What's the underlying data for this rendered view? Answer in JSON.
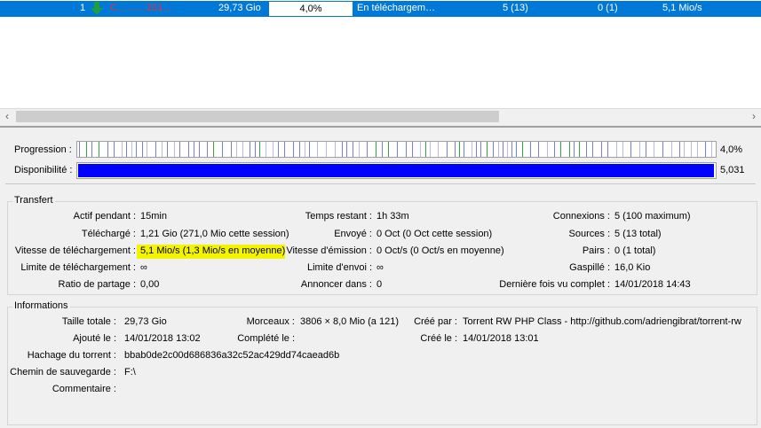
{
  "torrent_row": {
    "index": "1",
    "name": "C………201…",
    "size": "29,73 Gio",
    "progress": "4,0%",
    "status": "En téléchargem…",
    "seeds": "5 (13)",
    "peers": "0 (1)",
    "speed": "5,1 Mio/s",
    "status_icon": "download-arrow-icon"
  },
  "bars": {
    "progress_label": "Progression :",
    "progress_value": "4,0%",
    "progress_fraction": 0.04,
    "availability_label": "Disponibilité :",
    "availability_value": "5,031"
  },
  "transfer": {
    "title": "Transfert",
    "active_label": "Actif pendant :",
    "active_value": "15min",
    "downloaded_label": "Téléchargé :",
    "downloaded_value": "1,21 Gio (271,0 Mio cette session)",
    "dl_speed_label": "Vitesse de téléchargement :",
    "dl_speed_value": "5,1 Mio/s (1,3 Mio/s en moyenne)",
    "dl_limit_label": "Limite de téléchargement :",
    "dl_limit_value": "∞",
    "ratio_label": "Ratio de partage :",
    "ratio_value": "0,00",
    "eta_label": "Temps restant :",
    "eta_value": "1h 33m",
    "uploaded_label": "Envoyé :",
    "uploaded_value": "0 Oct (0 Oct cette session)",
    "ul_speed_label": "Vitesse d'émission :",
    "ul_speed_value": "0 Oct/s (0 Oct/s en moyenne)",
    "ul_limit_label": "Limite d'envoi :",
    "ul_limit_value": "∞",
    "announce_label": "Annoncer dans :",
    "announce_value": "0",
    "connections_label": "Connexions :",
    "connections_value": "5 (100 maximum)",
    "sources_label": "Sources :",
    "sources_value": "5 (13 total)",
    "peers_label": "Pairs :",
    "peers_value": "0 (1 total)",
    "wasted_label": "Gaspillé :",
    "wasted_value": "16,0 Kio",
    "last_complete_label": "Dernière fois vu complet :",
    "last_complete_value": "14/01/2018 14:43"
  },
  "info": {
    "title": "Informations",
    "total_size_label": "Taille totale :",
    "total_size_value": "29,73 Gio",
    "added_label": "Ajouté le :",
    "added_value": "14/01/2018 13:02",
    "hash_label": "Hachage du torrent :",
    "hash_value": "bbab0de2c00d686836a32c52ac429dd74caead6b",
    "save_path_label": "Chemin de sauvegarde :",
    "save_path_value": "F:\\",
    "comment_label": "Commentaire :",
    "comment_value": "",
    "pieces_label": "Morceaux :",
    "pieces_value": "3806 × 8,0 Mio (a 121)",
    "completed_label": "Complété le :",
    "completed_value": "",
    "created_by_label": "Créé par :",
    "created_by_value": "Torrent RW PHP Class - http://github.com/adriengibrat/torrent-rw",
    "created_on_label": "Créé le :",
    "created_on_value": "14/01/2018 13:01"
  },
  "colors": {
    "selection": "#0078d7",
    "availability": "#0000ff",
    "highlight": "#f4f400",
    "download_icon": "#1e9e3c"
  }
}
